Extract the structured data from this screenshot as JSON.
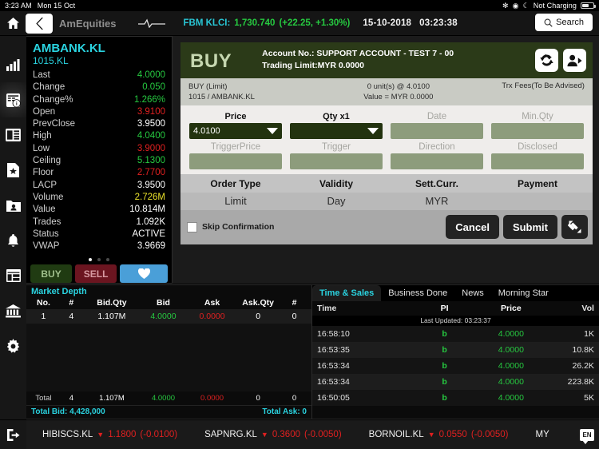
{
  "statusbar": {
    "time": "3:23 AM",
    "date": "Mon 15 Oct",
    "charging": "Not Charging"
  },
  "navbar": {
    "home_icon": "home-icon",
    "back_icon": "chevron-left-icon",
    "app_title": "AmEquities",
    "pulse_icon": "heartbeat-icon",
    "index_name": "FBM KLCI:",
    "index_value": "1,730.740",
    "index_change": "(+22.25, +1.30%)",
    "date": "15-10-2018",
    "time": "03:23:38",
    "search_label": "Search",
    "search_icon": "search-icon"
  },
  "sidebar": {
    "items": [
      {
        "name": "chart-icon",
        "label": "Charts",
        "active": false
      },
      {
        "name": "market-info-icon",
        "label": "Market Info",
        "active": true
      },
      {
        "name": "news-list-icon",
        "label": "News",
        "active": false
      },
      {
        "name": "document-star-icon",
        "label": "Watchlist",
        "active": false
      },
      {
        "name": "portfolio-folder-icon",
        "label": "Portfolio",
        "active": false
      },
      {
        "name": "bell-icon",
        "label": "Alerts",
        "active": false
      },
      {
        "name": "layout-icon",
        "label": "Layout",
        "active": false
      },
      {
        "name": "bank-icon",
        "label": "Account",
        "active": false
      },
      {
        "name": "gear-icon",
        "label": "Settings",
        "active": false
      }
    ]
  },
  "quote": {
    "symbol": "AMBANK.KL",
    "code": "1015.KL",
    "rows": [
      {
        "label": "Last",
        "value": "4.0000",
        "state": "up"
      },
      {
        "label": "Change",
        "value": "0.050",
        "state": "up"
      },
      {
        "label": "Change%",
        "value": "1.266%",
        "state": "up"
      },
      {
        "label": "Open",
        "value": "3.9100",
        "state": "down"
      },
      {
        "label": "PrevClose",
        "value": "3.9500",
        "state": "neutral"
      },
      {
        "label": "High",
        "value": "4.0400",
        "state": "up"
      },
      {
        "label": "Low",
        "value": "3.9000",
        "state": "down"
      },
      {
        "label": "Ceiling",
        "value": "5.1300",
        "state": "up"
      },
      {
        "label": "Floor",
        "value": "2.7700",
        "state": "down"
      },
      {
        "label": "LACP",
        "value": "3.9500",
        "state": "neutral"
      },
      {
        "label": "Volume",
        "value": "2.726M",
        "state": "vol"
      },
      {
        "label": "Value",
        "value": "10.814M",
        "state": "neutral"
      },
      {
        "label": "Trades",
        "value": "1.092K",
        "state": "neutral"
      },
      {
        "label": "Status",
        "value": "ACTIVE",
        "state": "neutral"
      },
      {
        "label": "VWAP",
        "value": "3.9669",
        "state": "neutral"
      }
    ],
    "page_dots": 3,
    "active_dot": 0,
    "buy_label": "BUY",
    "sell_label": "SELL",
    "favourite_icon": "heart-icon"
  },
  "ticket": {
    "side": "BUY",
    "account_label": "Account No.:",
    "account_value": "SUPPORT ACCOUNT - TEST 7 - 00",
    "trading_limit": "Trading Limit:MYR 0.0000",
    "refresh_icon": "refresh-icon",
    "account_switch_icon": "account-switch-icon",
    "summary_left_line1": "BUY (Limit)",
    "summary_left_line2": "1015 / AMBANK.KL",
    "summary_mid_line1": "0 unit(s) @ 4.0100",
    "summary_mid_line2": "Value = MYR 0.0000",
    "summary_right": "Trx Fees(To Be Advised)",
    "fields_row1": [
      {
        "label": "Price",
        "value": "4.0100",
        "active": true,
        "dropdown": true
      },
      {
        "label": "Qty x1",
        "value": "",
        "active": true,
        "dropdown": true
      },
      {
        "label": "Date",
        "value": "",
        "active": false,
        "dropdown": false
      },
      {
        "label": "Min.Qty",
        "value": "",
        "active": false,
        "dropdown": false
      }
    ],
    "fields_row2": [
      {
        "label": "TriggerPrice",
        "value": "",
        "active": false,
        "dropdown": false
      },
      {
        "label": "Trigger",
        "value": "",
        "active": false,
        "dropdown": false
      },
      {
        "label": "Direction",
        "value": "",
        "active": false,
        "dropdown": false
      },
      {
        "label": "Disclosed",
        "value": "",
        "active": false,
        "dropdown": false
      }
    ],
    "columns": [
      "Order Type",
      "Validity",
      "Sett.Curr.",
      "Payment"
    ],
    "values": [
      "Limit",
      "Day",
      "MYR",
      ""
    ],
    "skip_confirmation_label": "Skip Confirmation",
    "skip_confirmation_checked": false,
    "cancel_label": "Cancel",
    "submit_label": "Submit",
    "expand_icon": "expand-arrows-icon"
  },
  "market_depth": {
    "title": "Market Depth",
    "columns": [
      "No.",
      "#",
      "Bid.Qty",
      "Bid",
      "Ask",
      "Ask.Qty",
      "#"
    ],
    "rows": [
      {
        "no": "1",
        "bid_count": "4",
        "bid_qty": "1.107M",
        "bid": "4.0000",
        "ask": "0.0000",
        "ask_qty": "0",
        "ask_count": "0"
      }
    ],
    "total_row": {
      "no": "Total",
      "bid_count": "4",
      "bid_qty": "1.107M",
      "bid": "4.0000",
      "ask": "0.0000",
      "ask_qty": "0",
      "ask_count": "0"
    },
    "total_bid": "Total Bid: 4,428,000",
    "total_ask": "Total Ask: 0"
  },
  "time_sales": {
    "tabs": [
      {
        "label": "Time & Sales",
        "active": true
      },
      {
        "label": "Business Done",
        "active": false
      },
      {
        "label": "News",
        "active": false
      },
      {
        "label": "Morning Star",
        "active": false
      }
    ],
    "columns": [
      "Time",
      "PI",
      "Price",
      "Vol"
    ],
    "last_updated": "Last Updated: 03:23:37",
    "rows": [
      {
        "time": "16:58:10",
        "pi": "b",
        "price": "4.0000",
        "vol": "1K"
      },
      {
        "time": "16:53:35",
        "pi": "b",
        "price": "4.0000",
        "vol": "10.8K"
      },
      {
        "time": "16:53:34",
        "pi": "b",
        "price": "4.0000",
        "vol": "26.2K"
      },
      {
        "time": "16:53:34",
        "pi": "b",
        "price": "4.0000",
        "vol": "223.8K"
      },
      {
        "time": "16:50:05",
        "pi": "b",
        "price": "4.0000",
        "vol": "5K"
      }
    ]
  },
  "ticker": {
    "logout_icon": "logout-icon",
    "items": [
      {
        "symbol": "HIBISCS.KL",
        "arrow": "▼",
        "price": "1.1800",
        "change": "(-0.0100)"
      },
      {
        "symbol": "SAPNRG.KL",
        "arrow": "▼",
        "price": "0.3600",
        "change": "(-0.0050)"
      },
      {
        "symbol": "BORNOIL.KL",
        "arrow": "▼",
        "price": "0.0550",
        "change": "(-0.0050)"
      }
    ],
    "truncated": "MY",
    "language": "EN"
  },
  "colors": {
    "up": "#26c940",
    "down": "#e02020",
    "accent": "#2ad3e0",
    "buy_panel": "#2b3a18"
  }
}
